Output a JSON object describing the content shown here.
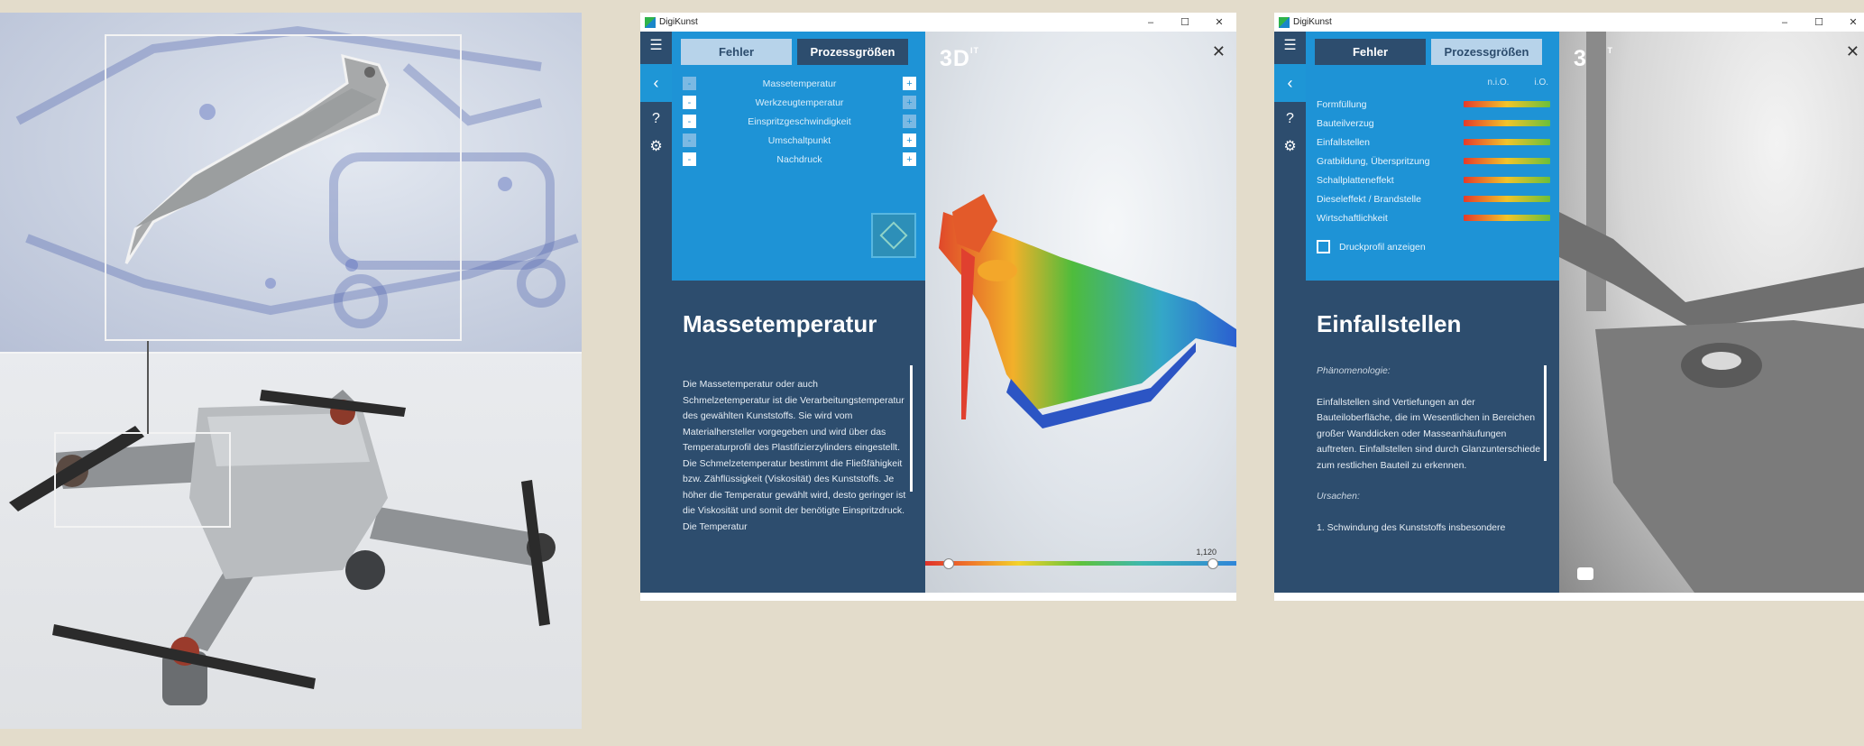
{
  "app": {
    "title": "DigiKunst",
    "controls": {
      "minimize": "–",
      "maximize": "☐",
      "close": "✕"
    }
  },
  "window1": {
    "tabs": [
      "Fehler",
      "Prozessgrößen"
    ],
    "active_tab": "Prozessgrößen",
    "params": [
      "Massetemperatur",
      "Werkzeugtemperatur",
      "Einspritzgeschwindigkeit",
      "Umschaltpunkt",
      "Nachdruck"
    ],
    "heading": "Massetemperatur",
    "description": "Die Massetemperatur oder auch Schmelzetemperatur ist die Verarbeitungstemperatur des gewählten Kunststoffs. Sie wird vom Materialhersteller vorgegeben und wird über das Temperaturprofil des Plastifizierzylinders eingestellt. Die Schmelzetemperatur bestimmt die Fließfähigkeit bzw. Zähflüssigkeit (Viskosität) des Kunststoffs. Je höher die Temperatur gewählt wird, desto geringer ist die Viskosität und somit der benötigte Einspritzdruck. Die Temperatur",
    "brand": "3D",
    "brand_sup": "IT",
    "colorbar_value": "1,120"
  },
  "window2": {
    "tabs": [
      "Fehler",
      "Prozessgrößen"
    ],
    "active_tab": "Fehler",
    "col_headers": [
      "n.i.O.",
      "i.O."
    ],
    "defects": [
      "Formfüllung",
      "Bauteilverzug",
      "Einfallstellen",
      "Gratbildung, Überspritzung",
      "Schallplatteneffekt",
      "Dieseleffekt / Brandstelle",
      "Wirtschaftlichkeit"
    ],
    "checkbox_label": "Druckprofil anzeigen",
    "heading": "Einfallstellen",
    "section1_title": "Phänomenologie:",
    "section1_text": "Einfallstellen sind Vertiefungen an der Bauteiloberfläche, die im Wesentlichen in Bereichen großer Wanddicken oder Masseanhäufungen auftreten. Einfallstellen sind durch Glanzunterschiede zum restlichen Bauteil zu erkennen.",
    "section2_title": "Ursachen:",
    "section2_text": "1. Schwindung des Kunststoffs insbesondere",
    "brand": "3D",
    "brand_sup": "IT"
  },
  "icons": [
    "hamburger-icon",
    "back-chevron-icon",
    "help-icon",
    "gear-icon",
    "camera-icon",
    "close-icon"
  ]
}
